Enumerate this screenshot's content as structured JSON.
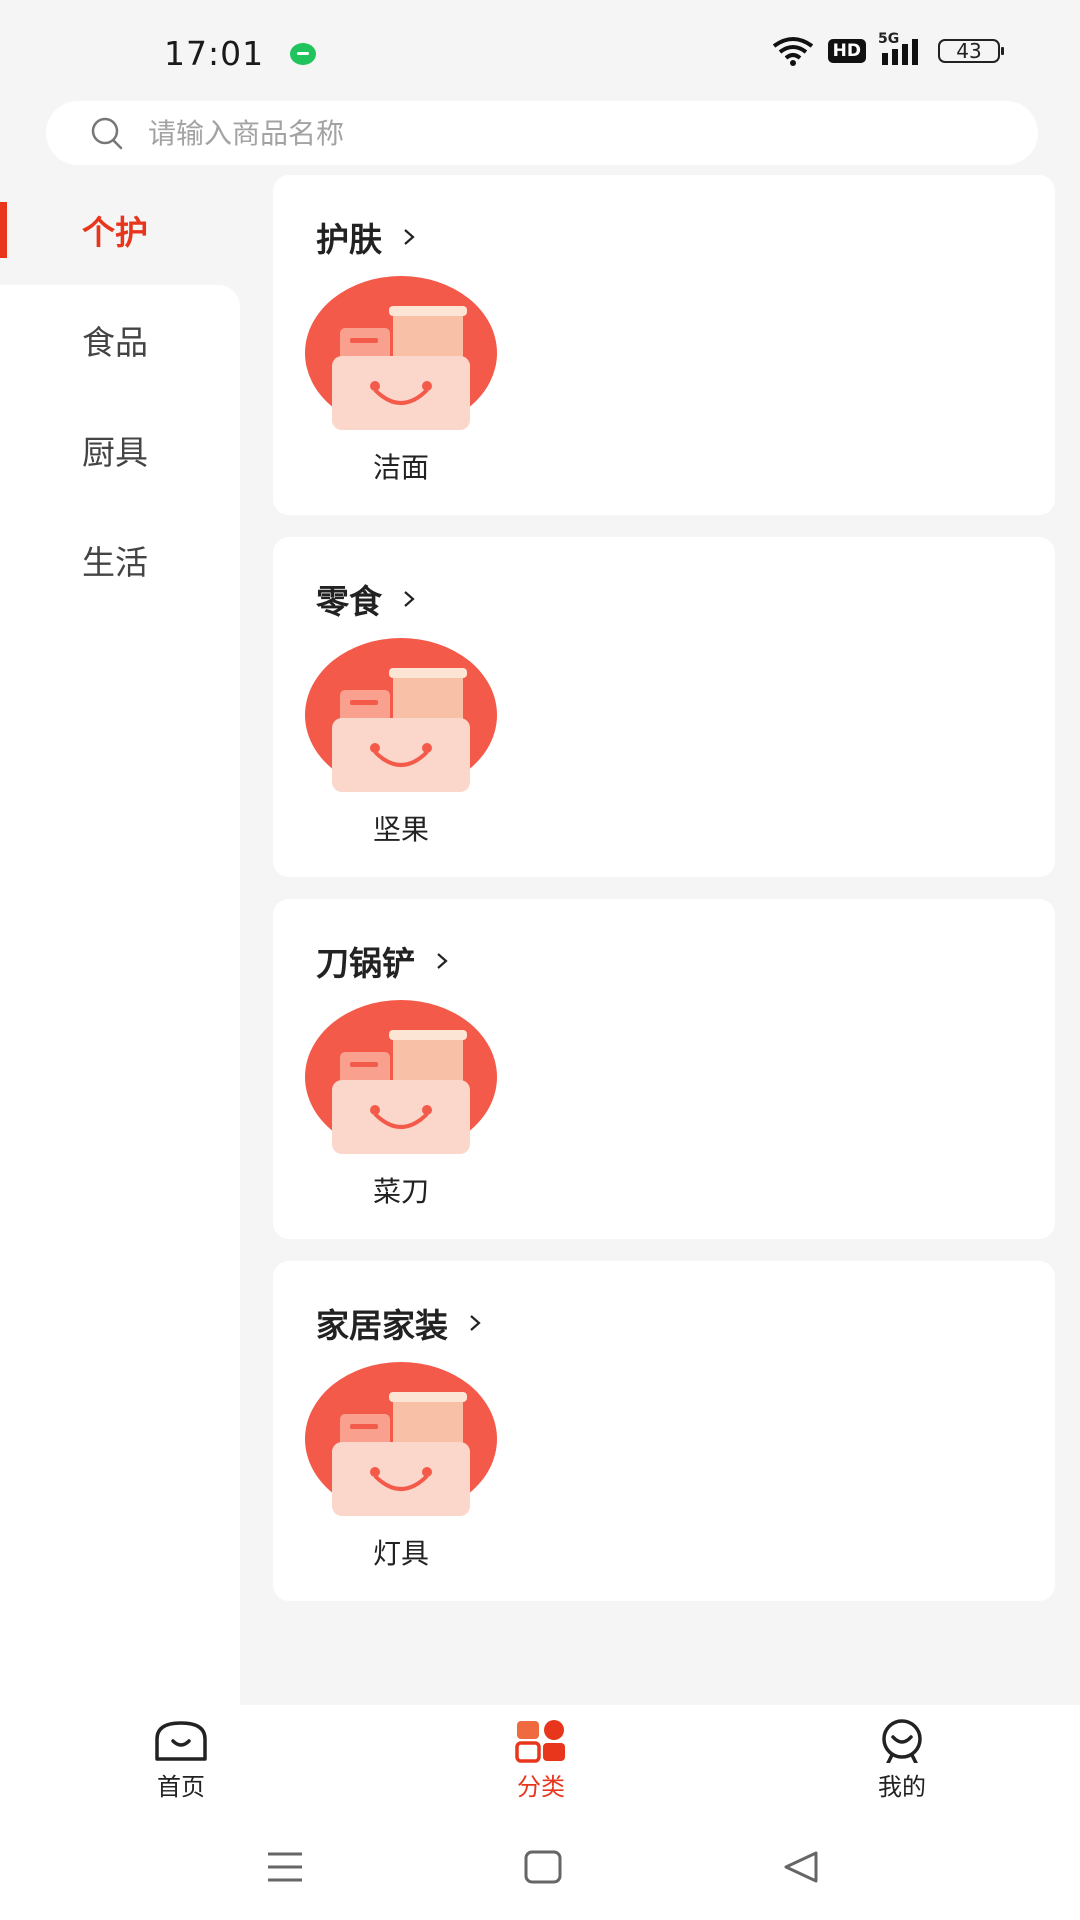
{
  "status_bar": {
    "time": "17:01",
    "network": "5G",
    "hd": "HD",
    "battery": "43"
  },
  "search": {
    "placeholder": "请输入商品名称"
  },
  "sidebar": {
    "items": [
      {
        "label": "个护",
        "active": true
      },
      {
        "label": "食品",
        "active": false
      },
      {
        "label": "厨具",
        "active": false
      },
      {
        "label": "生活",
        "active": false
      }
    ]
  },
  "categories": [
    {
      "title": "护肤",
      "items": [
        {
          "label": "洁面"
        }
      ]
    },
    {
      "title": "零食",
      "items": [
        {
          "label": "坚果"
        }
      ]
    },
    {
      "title": "刀锅铲",
      "items": [
        {
          "label": "菜刀"
        }
      ]
    },
    {
      "title": "家居家装",
      "items": [
        {
          "label": "灯具"
        }
      ]
    }
  ],
  "tab_bar": {
    "tabs": [
      {
        "label": "首页",
        "active": false,
        "icon": "home-face-icon"
      },
      {
        "label": "分类",
        "active": true,
        "icon": "category-grid-icon"
      },
      {
        "label": "我的",
        "active": false,
        "icon": "profile-face-icon"
      }
    ]
  },
  "colors": {
    "accent": "#e8361d",
    "background": "#f5f5f5",
    "card": "#ffffff"
  }
}
